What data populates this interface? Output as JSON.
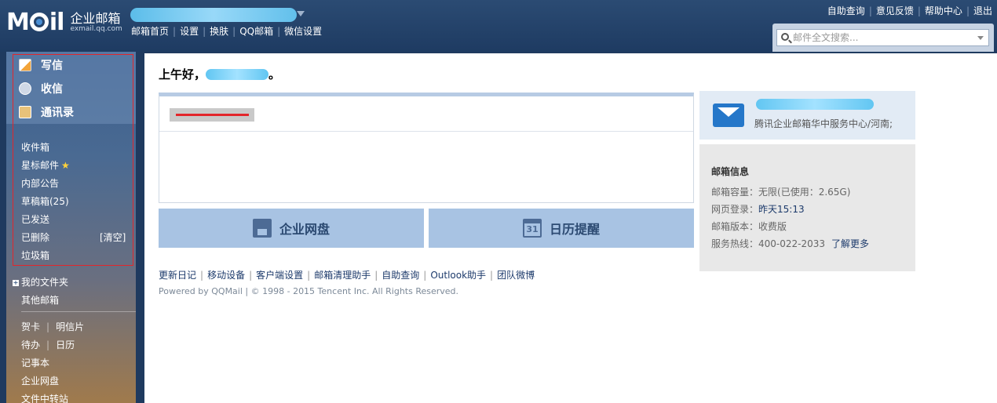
{
  "app": {
    "logo_text": "M il",
    "logo_cn": "企业邮箱",
    "logo_url": "exmail.qq.com"
  },
  "topnav": [
    "邮箱首页",
    "设置",
    "换肤",
    "QQ邮箱",
    "微信设置"
  ],
  "toplinks": [
    "自助查询",
    "意见反馈",
    "帮助中心",
    "退出"
  ],
  "search": {
    "placeholder": "邮件全文搜索..."
  },
  "sidebar": {
    "primary": [
      {
        "label": "写信",
        "icon": "compose-icon"
      },
      {
        "label": "收信",
        "icon": "inbox-icon"
      },
      {
        "label": "通讯录",
        "icon": "contacts-icon"
      }
    ],
    "folders": [
      "收件箱",
      "星标邮件",
      "内部公告",
      "草稿箱(25)",
      "已发送",
      "已删除",
      "垃圾箱"
    ],
    "clear_label": "[清空]",
    "my_folders": "我的文件夹",
    "other_mail": "其他邮箱",
    "tools": [
      [
        "贺卡",
        "明信片"
      ],
      [
        "待办",
        "日历"
      ]
    ],
    "extra": [
      "记事本",
      "企业网盘",
      "文件中转站"
    ]
  },
  "main": {
    "greeting": "上午好，",
    "greeting_suffix": "。",
    "buttons": [
      {
        "label": "企业网盘",
        "icon": "disk-icon"
      },
      {
        "label": "日历提醒",
        "icon": "calendar-icon",
        "icon_text": "31"
      }
    ],
    "footer_links": [
      "更新日记",
      "移动设备",
      "客户端设置",
      "邮箱清理助手",
      "自助查询",
      "Outlook助手",
      "团队微博"
    ],
    "copyright": "Powered by QQMail  | © 1998 - 2015 Tencent Inc. All Rights Reserved."
  },
  "company_card": {
    "name": "腾讯企业邮箱华中服务中心/河南;"
  },
  "mailbox_info": {
    "title": "邮箱信息",
    "capacity_label": "邮箱容量：",
    "capacity_value": "无限(已使用：2.65G)",
    "web_login_label": "网页登录：",
    "web_login_value": "昨天15:13",
    "version_label": "邮箱版本：",
    "version_value": "收费版",
    "hotline_label": "服务热线：",
    "hotline_value": "400-022-2033",
    "more_link": "了解更多"
  },
  "colors": {
    "topbar": "#1e3b62",
    "button_bg": "#a8c3e3",
    "highlight_box": "#e3262b",
    "link": "#1c3a6b"
  }
}
